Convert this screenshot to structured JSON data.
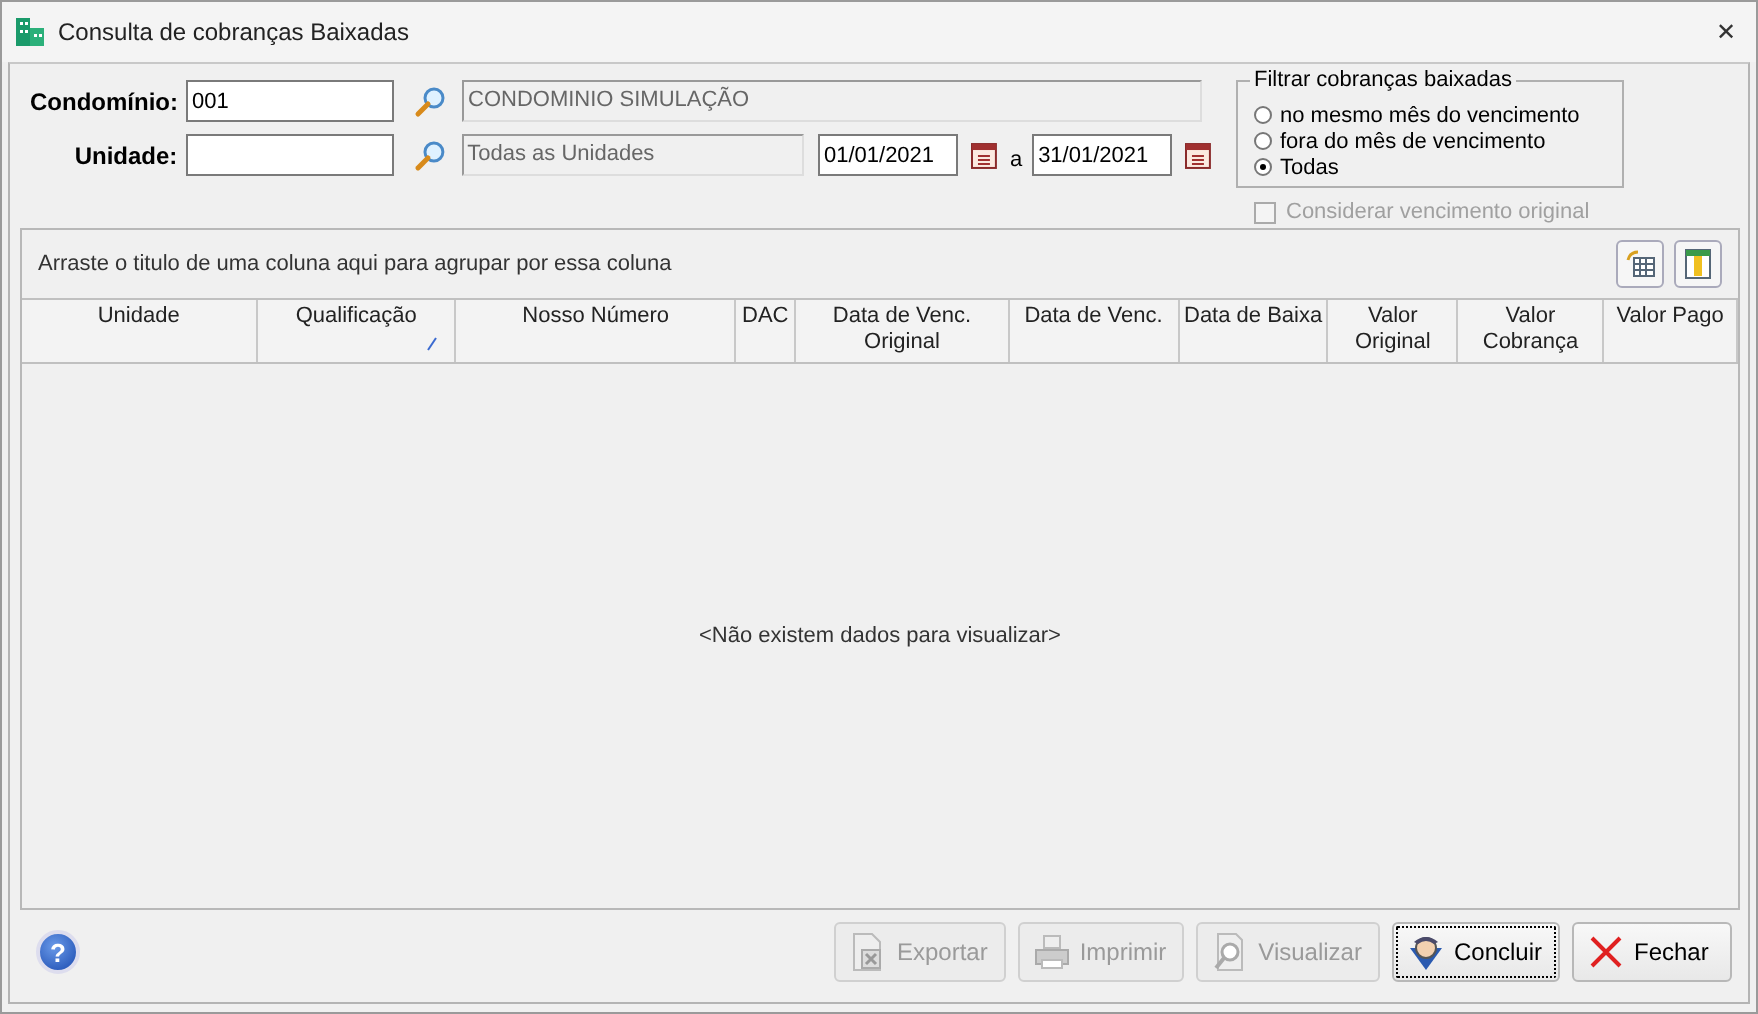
{
  "window": {
    "title": "Consulta de cobranças Baixadas",
    "close": "✕"
  },
  "form": {
    "condominio": {
      "label": "Condomínio:",
      "value": "001",
      "name": "CONDOMINIO SIMULAÇÃO"
    },
    "unidade": {
      "label": "Unidade:",
      "name": "Todas as Unidades"
    },
    "date_from": "01/01/2021",
    "date_sep": "a",
    "date_to": "31/01/2021"
  },
  "filter": {
    "title": "Filtrar cobranças baixadas",
    "options": [
      {
        "label": "no mesmo mês do vencimento",
        "selected": false
      },
      {
        "label": "fora do mês de vencimento",
        "selected": false
      },
      {
        "label": "Todas",
        "selected": true
      }
    ]
  },
  "consider_original": {
    "label": "Considerar vencimento original",
    "checked": false,
    "disabled": true
  },
  "grid": {
    "group_hint": "Arraste o titulo de uma coluna aqui para agrupar por essa coluna",
    "columns": [
      {
        "label": "Unidade",
        "sorted": false
      },
      {
        "label": "Qualificação",
        "sorted": true
      },
      {
        "label": "Nosso Número",
        "sorted": false
      },
      {
        "label": "DAC",
        "sorted": false
      },
      {
        "label": "Data de Venc. Original",
        "sorted": false
      },
      {
        "label": "Data de Venc.",
        "sorted": false
      },
      {
        "label": "Data de Baixa",
        "sorted": false
      },
      {
        "label": "Valor Original",
        "sorted": false
      },
      {
        "label": "Valor Cobrança",
        "sorted": false
      },
      {
        "label": "Valor Pago",
        "sorted": false
      }
    ],
    "empty": "<Não existem dados para visualizar>"
  },
  "help": "?",
  "buttons": [
    {
      "label": "Exportar",
      "kind": "export",
      "disabled": true
    },
    {
      "label": "Imprimir",
      "kind": "print",
      "disabled": true
    },
    {
      "label": "Visualizar",
      "kind": "preview",
      "disabled": true
    },
    {
      "label": "Concluir",
      "kind": "done",
      "disabled": false
    },
    {
      "label": "Fechar",
      "kind": "close",
      "disabled": false
    }
  ]
}
